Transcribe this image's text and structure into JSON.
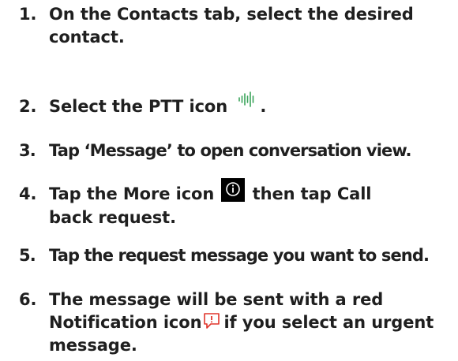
{
  "steps": [
    {
      "number": "1.",
      "text": "On the Contacts tab, select the desired contact."
    },
    {
      "number": "2.",
      "before": "Select the PTT icon",
      "icon": "ptt-waveform-icon",
      "after": "."
    },
    {
      "number": "3.",
      "text": "Tap ‘Message’ to open conversation view."
    },
    {
      "number": "4.",
      "before": "Tap the More icon",
      "icon": "more-info-icon",
      "after_line1": "then tap Call",
      "after_line2": "back request."
    },
    {
      "number": "5.",
      "text": "Tap the request message you want to send."
    },
    {
      "number": "6.",
      "line1": "The message will be sent with a red",
      "line2_before": "Notification icon",
      "icon": "red-notification-icon",
      "line2_after": "if you select an urgent",
      "line3": "message."
    }
  ],
  "colors": {
    "text": "#1f1f1f",
    "ptt_icon": "#3aa35a",
    "more_icon_bg": "#000000",
    "notification_icon": "#e0352b"
  }
}
